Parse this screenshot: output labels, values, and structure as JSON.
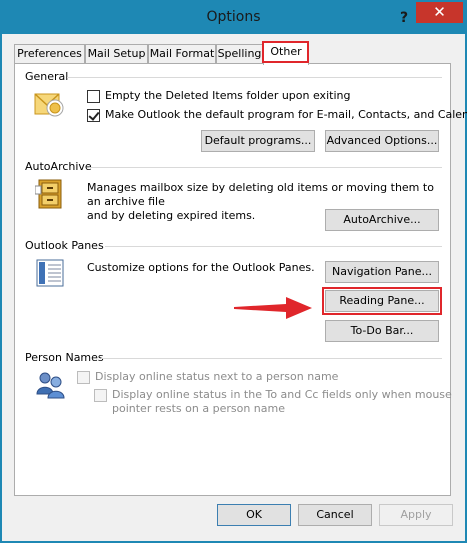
{
  "window": {
    "title": "Options",
    "help_glyph": "?",
    "close_glyph": "✕"
  },
  "tabs": [
    {
      "label": "Preferences"
    },
    {
      "label": "Mail Setup"
    },
    {
      "label": "Mail Format"
    },
    {
      "label": "Spelling"
    },
    {
      "label": "Other",
      "active": true
    }
  ],
  "general": {
    "heading": "General",
    "icon": "outlook-envelope-icon",
    "empty_deleted_label": "Empty the Deleted Items folder upon exiting",
    "empty_deleted_checked": false,
    "make_default_label": "Make Outlook the default program for E-mail, Contacts, and Calendar.",
    "make_default_checked": true,
    "default_programs_button": "Default programs...",
    "advanced_options_button": "Advanced Options..."
  },
  "autoarchive": {
    "heading": "AutoArchive",
    "icon": "archive-cabinet-icon",
    "description_line1": "Manages mailbox size by deleting old items or moving them to an archive file",
    "description_line2": "and by deleting expired items.",
    "button": "AutoArchive..."
  },
  "outlook_panes": {
    "heading": "Outlook Panes",
    "icon": "panes-layout-icon",
    "description": "Customize options for the Outlook Panes.",
    "navigation_pane_button": "Navigation Pane...",
    "reading_pane_button": "Reading Pane...",
    "todo_bar_button": "To-Do Bar..."
  },
  "person_names": {
    "heading": "Person Names",
    "icon": "people-icon",
    "display_status_label": "Display online status next to a person name",
    "display_status_to_cc_line1": "Display online status in the To and Cc fields only when mouse",
    "display_status_to_cc_line2": "pointer rests on a person name"
  },
  "footer": {
    "ok_button": "OK",
    "cancel_button": "Cancel",
    "apply_button": "Apply"
  },
  "colors": {
    "titlebar": "#1e88b4",
    "close_button": "#c7352b",
    "highlight": "#e0262b"
  }
}
